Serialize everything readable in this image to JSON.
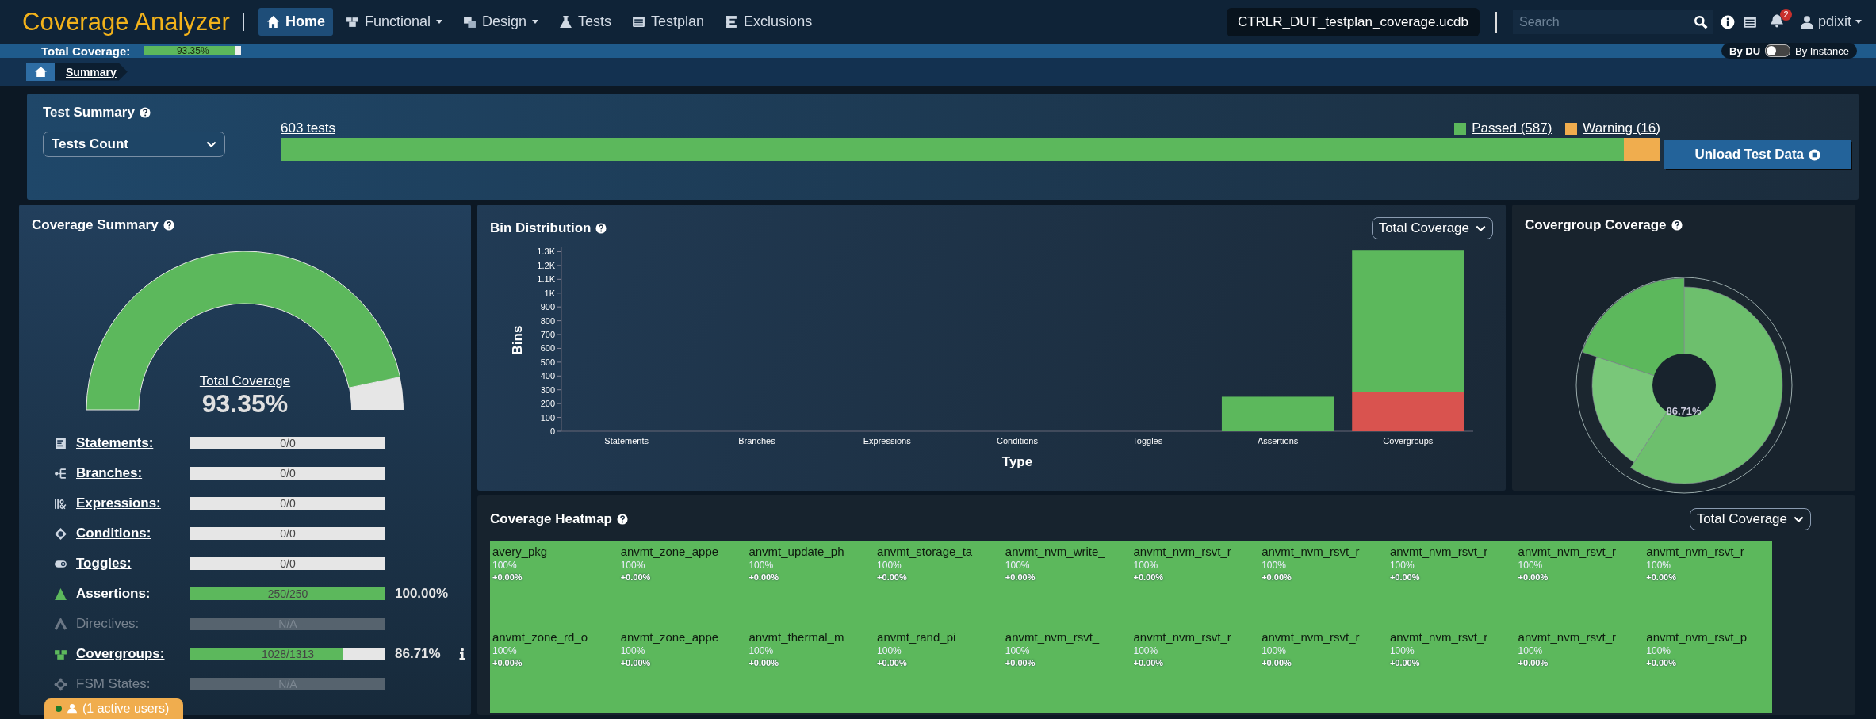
{
  "header": {
    "title": "Coverage Analyzer",
    "nav": [
      {
        "label": "Home",
        "kind": "home",
        "menu": false,
        "selected": true
      },
      {
        "label": "Functional",
        "kind": "functional",
        "menu": true,
        "selected": false
      },
      {
        "label": "Design",
        "kind": "design",
        "menu": true,
        "selected": false
      },
      {
        "label": "Tests",
        "kind": "tests",
        "menu": false,
        "selected": false
      },
      {
        "label": "Testplan",
        "kind": "testplan",
        "menu": false,
        "selected": false
      },
      {
        "label": "Exclusions",
        "kind": "exclusions",
        "menu": false,
        "selected": false
      }
    ],
    "database": "CTRLR_DUT_testplan_coverage.ucdb",
    "search": {
      "placeholder": "Search"
    },
    "notifications": "2",
    "user": "pdixit"
  },
  "coverage_bar": {
    "label": "Total Coverage:",
    "value": "93.35%",
    "level": 0.9335
  },
  "view_toggle": {
    "left": "By DU",
    "right": "By Instance",
    "on": false
  },
  "breadcrumb": [
    "Summary"
  ],
  "test_summary": {
    "title": "Test Summary",
    "selector": "Tests Count",
    "total": "603 tests",
    "legend": [
      {
        "label": "Passed (587)",
        "color": "#5cb85c"
      },
      {
        "label": "Warning (16)",
        "color": "#f0ad4e"
      }
    ],
    "level": 0.9735,
    "button": "Unload Test Data"
  },
  "coverage_summary": {
    "title": "Coverage Summary",
    "gauge_label": "Total Coverage",
    "gauge_value": "93.35%",
    "metrics": [
      {
        "kind": "statements",
        "label": "Statements:",
        "reading": "0/0",
        "level": 0,
        "disabled": false,
        "info": false
      },
      {
        "kind": "branches",
        "label": "Branches:",
        "reading": "0/0",
        "level": 0,
        "disabled": false,
        "info": false
      },
      {
        "kind": "expressions",
        "label": "Expressions:",
        "reading": "0/0",
        "level": 0,
        "disabled": false,
        "info": false
      },
      {
        "kind": "conditions",
        "label": "Conditions:",
        "reading": "0/0",
        "level": 0,
        "disabled": false,
        "info": false
      },
      {
        "kind": "toggles",
        "label": "Toggles:",
        "reading": "0/0",
        "level": 0,
        "disabled": false,
        "info": false
      },
      {
        "kind": "assertions",
        "label": "Assertions:",
        "reading": "250/250",
        "level": 1,
        "percent": "100.00%",
        "disabled": false,
        "info": false
      },
      {
        "kind": "directives",
        "label": "Directives:",
        "reading": "N/A",
        "level": 0,
        "disabled": true,
        "info": false
      },
      {
        "kind": "covergroups",
        "label": "Covergroups:",
        "reading": "1028/1313",
        "level": 0.7829,
        "percent": "86.71%",
        "disabled": false,
        "info": true
      },
      {
        "kind": "fsm",
        "label": "FSM States:",
        "reading": "N/A",
        "level": 0,
        "disabled": true,
        "info": false
      }
    ]
  },
  "bin_distribution": {
    "title": "Bin Distribution",
    "selector": "Total Coverage",
    "chart_data": {
      "type": "bar",
      "stacked": true,
      "xlabel": "Type",
      "ylabel": "Bins",
      "categories": [
        "Statements",
        "Branches",
        "Expressions",
        "Conditions",
        "Toggles",
        "Assertions",
        "Covergroups"
      ],
      "ylim": [
        0,
        1320
      ],
      "yticks": [
        0,
        100,
        200,
        300,
        400,
        500,
        600,
        700,
        800,
        900,
        {
          "value": 1000,
          "label": "1K"
        },
        {
          "value": 1100,
          "label": "1.1K"
        },
        {
          "value": 1200,
          "label": "1.2K"
        },
        {
          "value": 1300,
          "label": "1.3K"
        }
      ],
      "series": [
        {
          "color": "#d9534f",
          "values": [
            0,
            0,
            0,
            0,
            0,
            0,
            285
          ]
        },
        {
          "color": "#5cb85c",
          "values": [
            0,
            0,
            0,
            0,
            0,
            250,
            1028
          ]
        }
      ]
    }
  },
  "covergroup_coverage": {
    "title": "Covergroup Coverage",
    "center": "86.71%"
  },
  "heatmap": {
    "title": "Coverage Heatmap",
    "selector": "Total Coverage",
    "cells": [
      {
        "name": "avery_pkg",
        "value": "100%",
        "delta": "+0.00%"
      },
      {
        "name": "anvmt_zone_appe",
        "value": "100%",
        "delta": "+0.00%"
      },
      {
        "name": "anvmt_update_ph",
        "value": "100%",
        "delta": "+0.00%"
      },
      {
        "name": "anvmt_storage_ta",
        "value": "100%",
        "delta": "+0.00%"
      },
      {
        "name": "anvmt_nvm_write_",
        "value": "100%",
        "delta": "+0.00%"
      },
      {
        "name": "anvmt_nvm_rsvt_r",
        "value": "100%",
        "delta": "+0.00%"
      },
      {
        "name": "anvmt_nvm_rsvt_r",
        "value": "100%",
        "delta": "+0.00%"
      },
      {
        "name": "anvmt_nvm_rsvt_r",
        "value": "100%",
        "delta": "+0.00%"
      },
      {
        "name": "anvmt_nvm_rsvt_r",
        "value": "100%",
        "delta": "+0.00%"
      },
      {
        "name": "anvmt_nvm_rsvt_r",
        "value": "100%",
        "delta": "+0.00%"
      },
      {
        "name": "anvmt_zone_rd_o",
        "value": "100%",
        "delta": "+0.00%"
      },
      {
        "name": "anvmt_zone_appe",
        "value": "100%",
        "delta": "+0.00%"
      },
      {
        "name": "anvmt_thermal_m",
        "value": "100%",
        "delta": "+0.00%"
      },
      {
        "name": "anvmt_rand_pi",
        "value": "100%",
        "delta": "+0.00%"
      },
      {
        "name": "anvmt_nvm_rsvt_",
        "value": "100%",
        "delta": "+0.00%"
      },
      {
        "name": "anvmt_nvm_rsvt_r",
        "value": "100%",
        "delta": "+0.00%"
      },
      {
        "name": "anvmt_nvm_rsvt_r",
        "value": "100%",
        "delta": "+0.00%"
      },
      {
        "name": "anvmt_nvm_rsvt_r",
        "value": "100%",
        "delta": "+0.00%"
      },
      {
        "name": "anvmt_nvm_rsvt_r",
        "value": "100%",
        "delta": "+0.00%"
      },
      {
        "name": "anvmt_nvm_rsvt_p",
        "value": "100%",
        "delta": "+0.00%"
      }
    ]
  },
  "footer": {
    "active_users": "(1 active users)"
  }
}
